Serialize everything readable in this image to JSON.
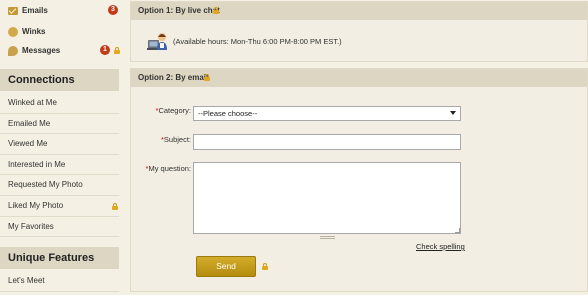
{
  "sidebar": {
    "messages": [
      {
        "label": "Emails",
        "badge": "3",
        "locked": false,
        "icon": "envelope-icon"
      },
      {
        "label": "Winks",
        "badge": "",
        "locked": false,
        "icon": "smiley-icon"
      },
      {
        "label": "Messages",
        "badge": "1",
        "locked": true,
        "icon": "chat-bubble-icon"
      }
    ],
    "connections_title": "Connections",
    "connections": [
      {
        "label": "Winked at Me",
        "locked": false
      },
      {
        "label": "Emailed Me",
        "locked": false
      },
      {
        "label": "Viewed Me",
        "locked": false
      },
      {
        "label": "Interested in Me",
        "locked": false
      },
      {
        "label": "Requested My Photo",
        "locked": false
      },
      {
        "label": "Liked My Photo",
        "locked": true
      },
      {
        "label": "My Favorites",
        "locked": false
      }
    ],
    "features_title": "Unique Features",
    "features": [
      {
        "label": "Let's Meet"
      }
    ]
  },
  "main": {
    "option1": {
      "title": "Option 1: By live chat",
      "hours": "(Available hours: Mon-Thu 6:00 PM-8:00 PM EST.)"
    },
    "option2": {
      "title": "Option 2: By email",
      "category_label": "Category:",
      "category_value": "--Please choose--",
      "subject_label": "Subject:",
      "subject_value": "",
      "question_label": "My question:",
      "question_value": "",
      "check_spelling": "Check spelling",
      "send_label": "Send"
    }
  },
  "colors": {
    "accent_gold": "#c9a21a",
    "badge_red": "#c23a1a",
    "lock_gold": "#e2a81d",
    "panel_header": "#ddd6c2",
    "background": "#f4f0e4"
  }
}
